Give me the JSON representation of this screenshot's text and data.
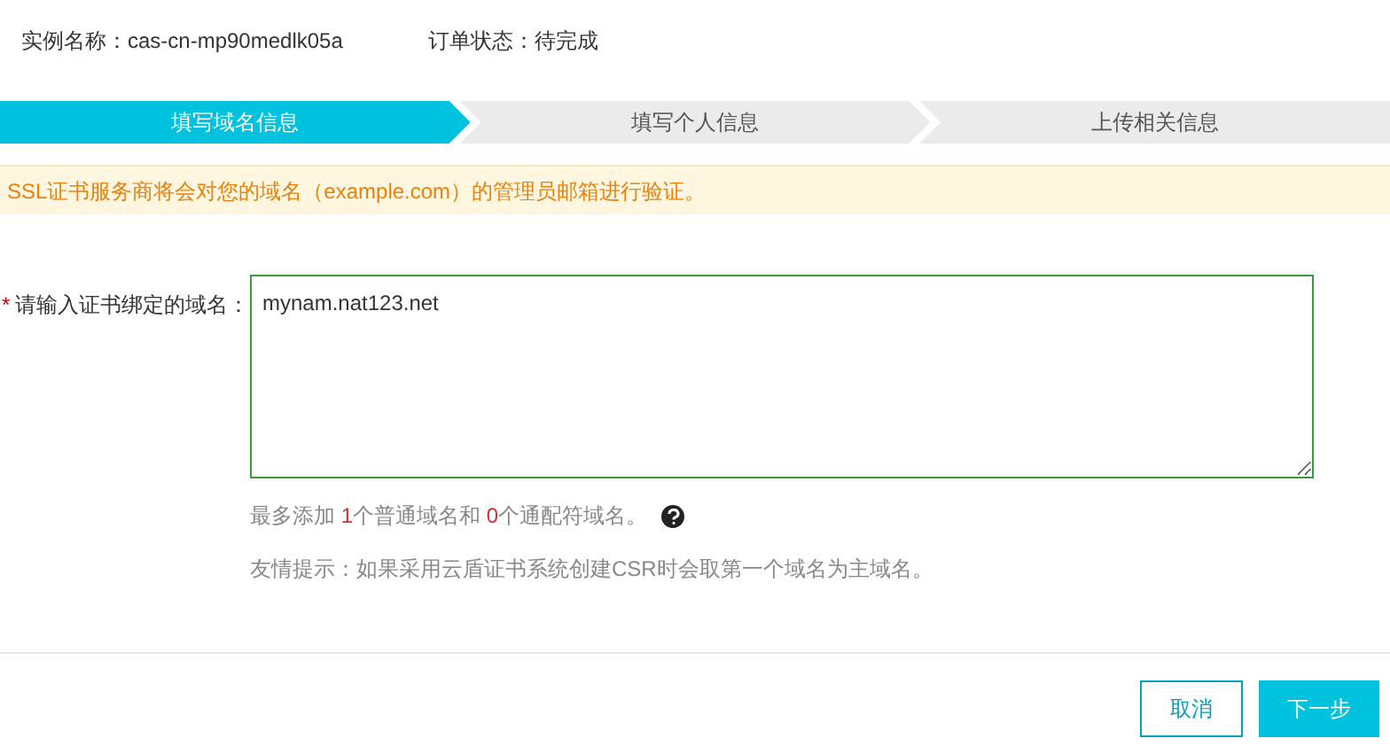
{
  "info": [
    {
      "label": "实例名称：",
      "value": "cas-cn-mp90medlk05a"
    },
    {
      "label": "订单状态：",
      "value": "待完成"
    }
  ],
  "steps": [
    {
      "label": "填写域名信息",
      "selected": true
    },
    {
      "label": "填写个人信息",
      "selected": false
    },
    {
      "label": "上传相关信息",
      "selected": false
    }
  ],
  "notice": "SSL证书服务商将会对您的域名（example.com）的管理员邮箱进行验证。",
  "form": {
    "required_mark": "*",
    "label": "请输入证书绑定的域名：",
    "value": "mynam.nat123.net",
    "limit_hint": [
      {
        "kind": "plain",
        "text": "最多添加 "
      },
      {
        "kind": "count",
        "text": "1"
      },
      {
        "kind": "plain",
        "text": "个普通域名和 "
      },
      {
        "kind": "count",
        "text": "0"
      },
      {
        "kind": "plain",
        "text": "个通配符域名。"
      }
    ],
    "tip": "友情提示：如果采用云盾证书系统创建CSR时会取第一个域名为主域名。"
  },
  "buttons": [
    {
      "kind": "secondary",
      "label": "取消"
    },
    {
      "kind": "primary",
      "label": "下一步"
    }
  ]
}
